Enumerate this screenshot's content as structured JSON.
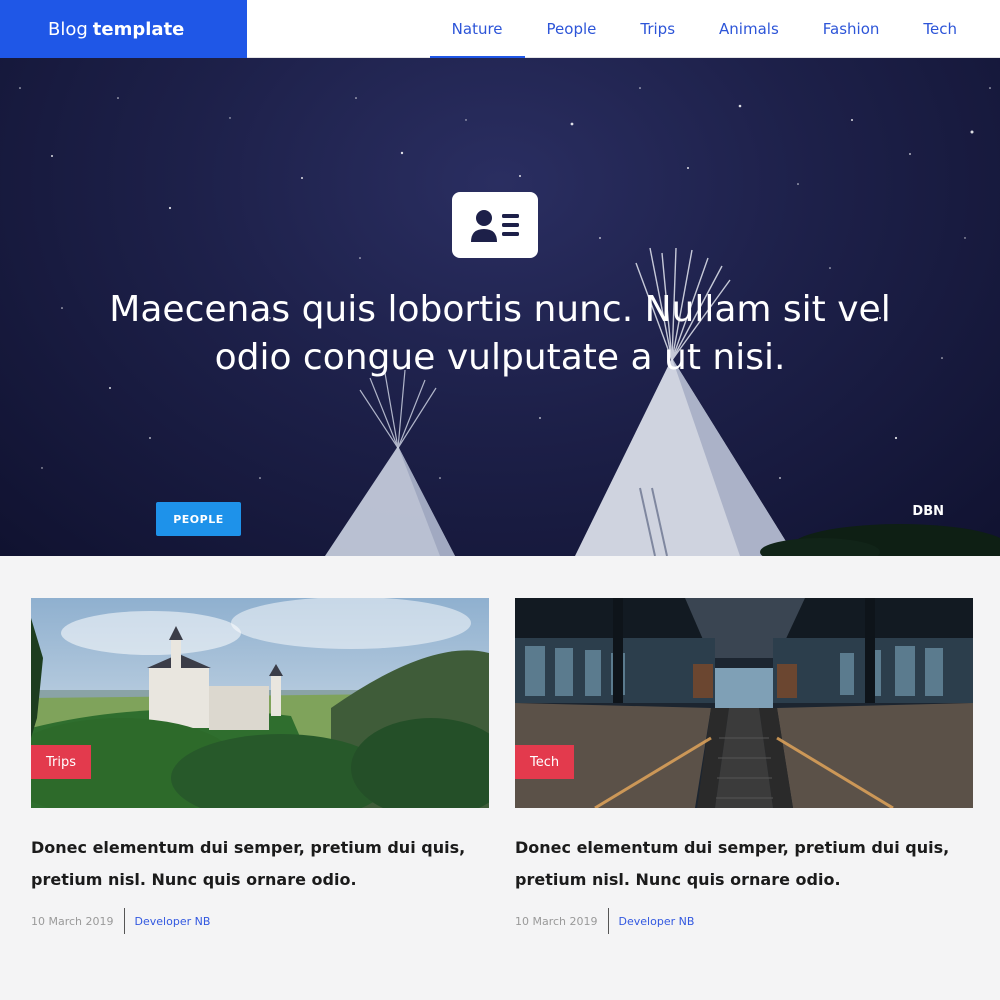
{
  "header": {
    "brand_light": "Blog",
    "brand_bold": "template",
    "nav": [
      "Nature",
      "People",
      "Trips",
      "Animals",
      "Fashion",
      "Tech"
    ],
    "active_nav": "Nature"
  },
  "hero": {
    "icon": "id-card-icon",
    "title": "Maecenas quis lobortis nunc. Nullam sit vel odio congue vulputate a ut nisi.",
    "category": "PEOPLE",
    "credit": "DBN"
  },
  "cards": [
    {
      "tag": "Trips",
      "title": "Donec elementum dui semper, pretium dui quis, pretium nisl. Nunc quis ornare odio.",
      "date": "10 March 2019",
      "author": "Developer NB"
    },
    {
      "tag": "Tech",
      "title": "Donec elementum dui semper, pretium dui quis, pretium nisl. Nunc quis ornare odio.",
      "date": "10 March 2019",
      "author": "Developer NB"
    }
  ],
  "colors": {
    "brand": "#1f57e7",
    "nav_text": "#2d55d8",
    "badge_blue": "#1e92ea",
    "tag_red": "#e33a4d"
  }
}
